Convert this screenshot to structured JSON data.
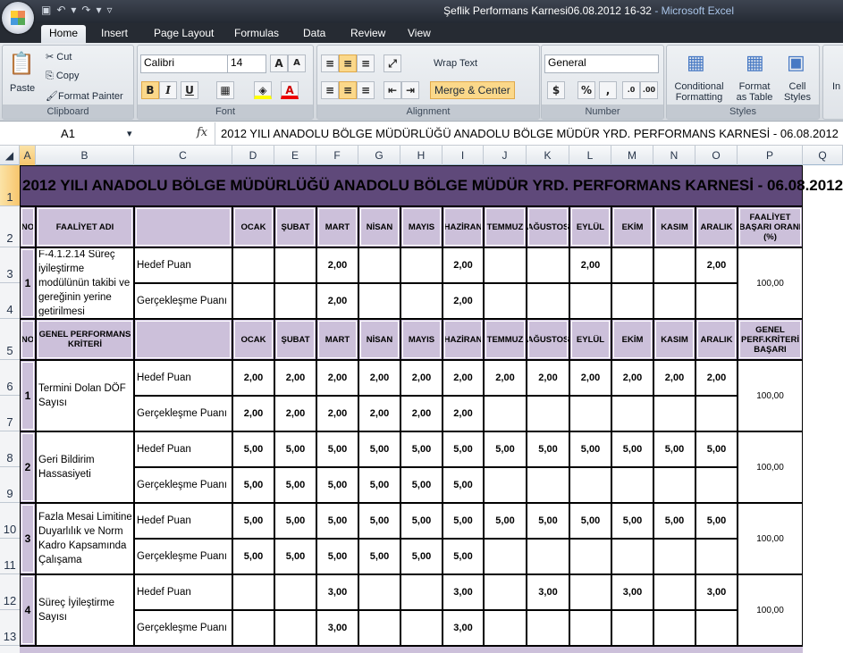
{
  "window": {
    "title": "Şeflik Performans Karnesi06.08.2012 16-32",
    "app": " - Microsoft Excel"
  },
  "ribbon_tabs": [
    "Home",
    "Insert",
    "Page Layout",
    "Formulas",
    "Data",
    "Review",
    "View"
  ],
  "clipboard": {
    "paste": "Paste",
    "cut": "Cut",
    "copy": "Copy",
    "format_painter": "Format Painter",
    "label": "Clipboard"
  },
  "font": {
    "name": "Calibri",
    "size": "14",
    "label": "Font",
    "bold": "B",
    "italic": "I",
    "underline": "U"
  },
  "alignment": {
    "wrap": "Wrap Text",
    "merge": "Merge & Center",
    "label": "Alignment"
  },
  "number": {
    "format": "General",
    "percent": "%",
    "comma": ",",
    "label": "Number"
  },
  "styles": {
    "conditional": "Conditional Formatting",
    "format_table": "Format as Table",
    "cell_styles": "Cell Styles",
    "label": "Styles",
    "insert": "In"
  },
  "formula_bar": {
    "name_box": "A1",
    "fx": "fx",
    "content": "2012 YILI ANADOLU BÖLGE MÜDÜRLÜĞÜ ANADOLU BÖLGE MÜDÜR YRD. PERFORMANS KARNESİ - 06.08.2012"
  },
  "columns": [
    "A",
    "B",
    "C",
    "D",
    "E",
    "F",
    "G",
    "H",
    "I",
    "J",
    "K",
    "L",
    "M",
    "N",
    "O",
    "P",
    "Q"
  ],
  "row_numbers": [
    "1",
    "2",
    "3",
    "4",
    "5",
    "6",
    "7",
    "8",
    "9",
    "10",
    "11",
    "12",
    "13"
  ],
  "sheet": {
    "title": "2012 YILI ANADOLU BÖLGE MÜDÜRLÜĞÜ ANADOLU BÖLGE MÜDÜR YRD. PERFORMANS KARNESİ - 06.08.2012",
    "months": [
      "OCAK",
      "ŞUBAT",
      "MART",
      "NİSAN",
      "MAYIS",
      "HAZİRAN",
      "TEMMUZ",
      "AĞUSTOS",
      "EYLÜL",
      "EKİM",
      "KASIM",
      "ARALIK"
    ],
    "header1": {
      "no": "NO",
      "name": "FAALİYET ADI",
      "rate": "FAALİYET BAŞARI ORANI (%)"
    },
    "header2": {
      "no": "NO",
      "name": "GENEL PERFORMANS KRİTERİ",
      "rate": "GENEL PERF.KRİTERİ BAŞARI"
    },
    "target_label": "Hedef Puan",
    "actual_label": "Gerçekleşme Puanı",
    "activities": [
      {
        "no": "1",
        "name": "F-4.1.2.14 Süreç iyileştirme modülünün takibi ve gereğinin yerine getirilmesi",
        "target": [
          "",
          "",
          "2,00",
          "",
          "",
          "2,00",
          "",
          "",
          "2,00",
          "",
          "",
          "2,00"
        ],
        "actual": [
          "",
          "",
          "2,00",
          "",
          "",
          "2,00",
          "",
          "",
          "",
          "",
          "",
          ""
        ],
        "rate": "100,00"
      }
    ],
    "criteria": [
      {
        "no": "1",
        "name": "Termini Dolan DÖF Sayısı",
        "target": [
          "2,00",
          "2,00",
          "2,00",
          "2,00",
          "2,00",
          "2,00",
          "2,00",
          "2,00",
          "2,00",
          "2,00",
          "2,00",
          "2,00"
        ],
        "actual": [
          "2,00",
          "2,00",
          "2,00",
          "2,00",
          "2,00",
          "2,00",
          "",
          "",
          "",
          "",
          "",
          ""
        ],
        "rate": "100,00"
      },
      {
        "no": "2",
        "name": "Geri Bildirim Hassasiyeti",
        "target": [
          "5,00",
          "5,00",
          "5,00",
          "5,00",
          "5,00",
          "5,00",
          "5,00",
          "5,00",
          "5,00",
          "5,00",
          "5,00",
          "5,00"
        ],
        "actual": [
          "5,00",
          "5,00",
          "5,00",
          "5,00",
          "5,00",
          "5,00",
          "",
          "",
          "",
          "",
          "",
          ""
        ],
        "rate": "100,00"
      },
      {
        "no": "3",
        "name": "Fazla Mesai Limitine Duyarlılık ve Norm Kadro Kapsamında Çalışama",
        "target": [
          "5,00",
          "5,00",
          "5,00",
          "5,00",
          "5,00",
          "5,00",
          "5,00",
          "5,00",
          "5,00",
          "5,00",
          "5,00",
          "5,00"
        ],
        "actual": [
          "5,00",
          "5,00",
          "5,00",
          "5,00",
          "5,00",
          "5,00",
          "",
          "",
          "",
          "",
          "",
          ""
        ],
        "rate": "100,00"
      },
      {
        "no": "4",
        "name": "Süreç İyileştirme Sayısı",
        "target": [
          "",
          "",
          "3,00",
          "",
          "",
          "3,00",
          "",
          "3,00",
          "",
          "3,00",
          "",
          "3,00"
        ],
        "actual": [
          "",
          "",
          "3,00",
          "",
          "",
          "3,00",
          "",
          "",
          "",
          "",
          "",
          ""
        ],
        "rate": "100,00"
      }
    ]
  }
}
